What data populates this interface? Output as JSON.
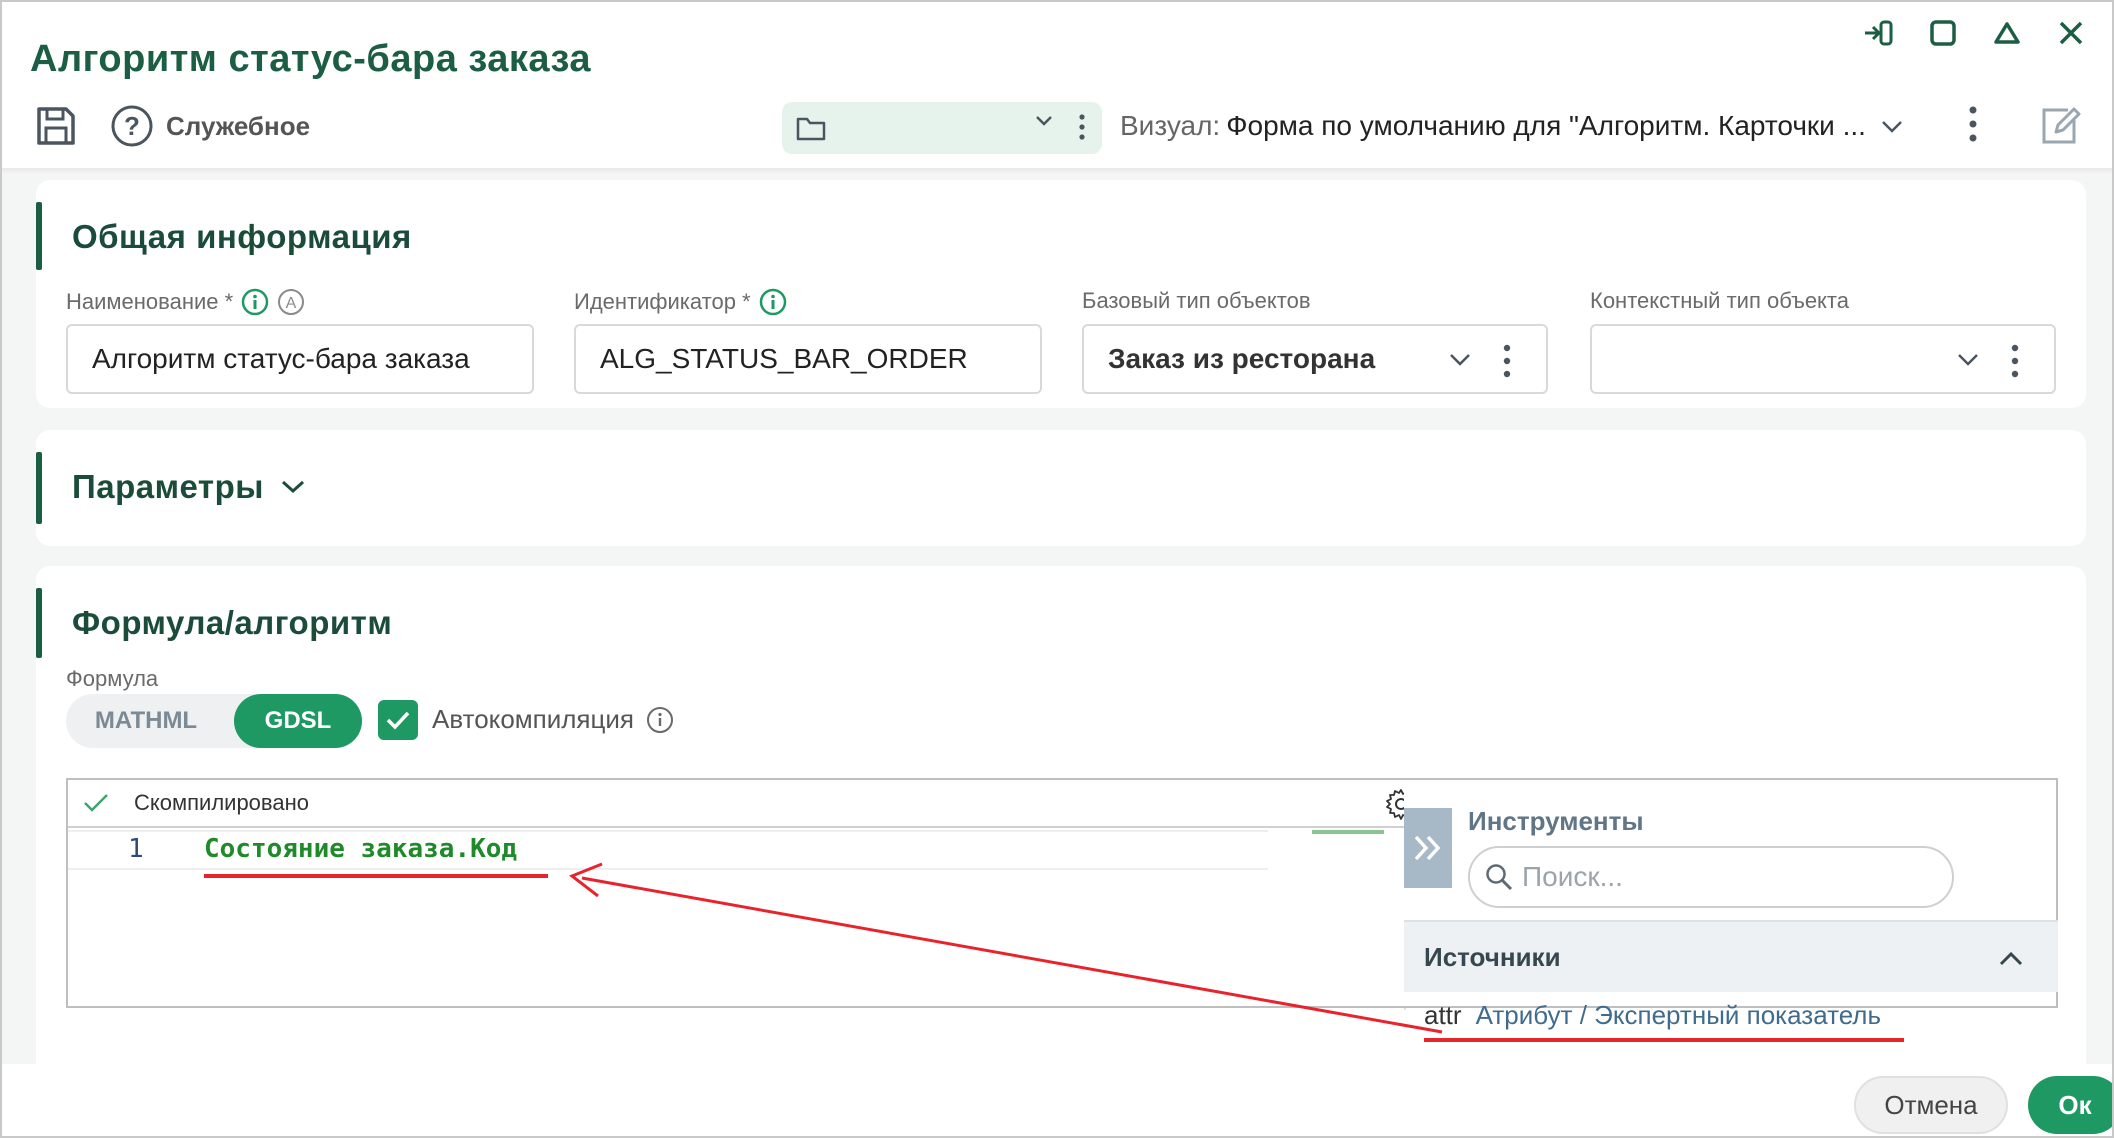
{
  "window": {
    "title": "Алгоритм статус-бара заказа"
  },
  "toolbar": {
    "help_label": "Служебное",
    "visual_label": "Визуал:",
    "visual_value": "Форма по умолчанию для \"Алгоритм. Карточки ..."
  },
  "general": {
    "title": "Общая информация",
    "fields": [
      {
        "label": "Наименование *",
        "value": "Алгоритм статус-бара заказа"
      },
      {
        "label": "Идентификатор *",
        "value": "ALG_STATUS_BAR_ORDER"
      },
      {
        "label": "Базовый тип объектов",
        "value": "Заказ из ресторана"
      },
      {
        "label": "Контекстный тип объекта",
        "value": ""
      }
    ]
  },
  "params": {
    "title": "Параметры"
  },
  "formula": {
    "title": "Формула/алгоритм",
    "label": "Формула",
    "modes": [
      "MATHML",
      "GDSL"
    ],
    "active_mode": "GDSL",
    "autocompile_label": "Автокомпиляция",
    "autocompile_checked": true,
    "editor_status": "Скомпилировано",
    "lines": [
      {
        "number": "1",
        "code": "Состояние заказа.Код"
      }
    ]
  },
  "tools": {
    "title": "Инструменты",
    "search_placeholder": "Поиск...",
    "sources_title": "Источники",
    "sources": [
      {
        "code": "attr",
        "description": "Атрибут / Экспертный показатель"
      }
    ]
  },
  "footer": {
    "cancel_label": "Отмена",
    "ok_label": "Ок"
  },
  "colors": {
    "accent": "#1e9963",
    "title": "#1b5e44",
    "annotation": "#e8232c"
  }
}
